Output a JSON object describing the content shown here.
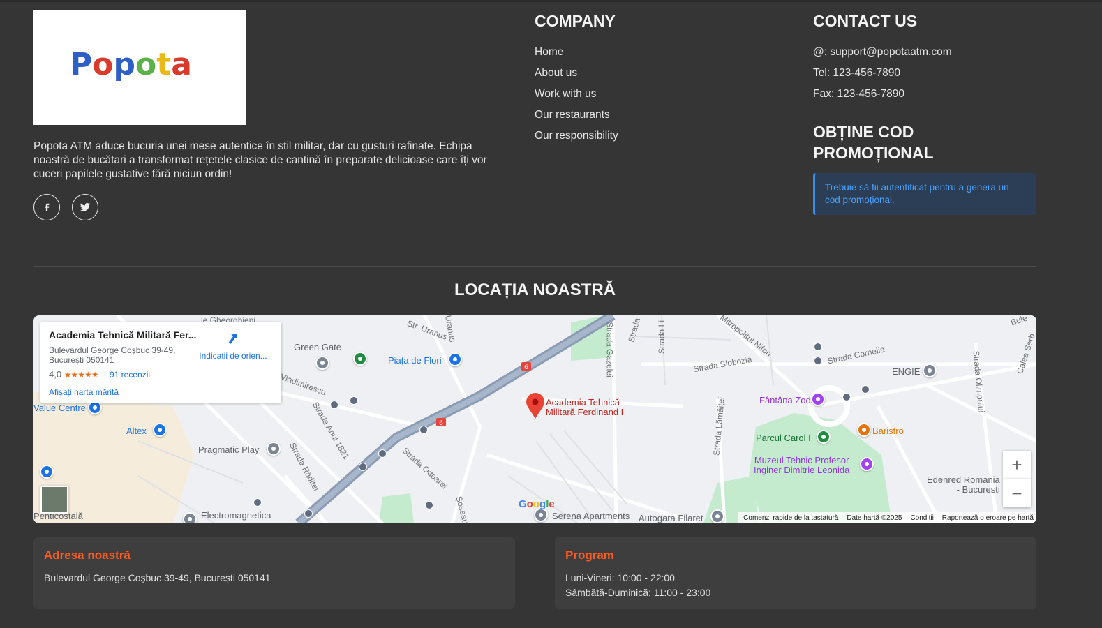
{
  "logo": {
    "text": "Popota"
  },
  "about": {
    "text": "Popota ATM aduce bucuria unei mese autentice în stil militar, dar cu gusturi rafinate. Echipa noastră de bucătari a transformat rețetele clasice de cantină în preparate delicioase care îți vor cuceri papilele gustative fără niciun ordin!"
  },
  "social": {
    "icons": [
      "facebook-icon",
      "twitter-icon"
    ]
  },
  "company": {
    "title": "COMPANY",
    "links": [
      "Home",
      "About us",
      "Work with us",
      "Our restaurants",
      "Our responsibility"
    ]
  },
  "contact": {
    "title": "CONTACT US",
    "email": "@: support@popotaatm.com",
    "tel": "Tel: 123-456-7890",
    "fax": "Fax: 123-456-7890"
  },
  "promo": {
    "title_line1": "OBȚINE COD",
    "title_line2": "PROMOȚIONAL",
    "alert": "Trebuie să fii autentificat pentru a genera un cod promoțional."
  },
  "location": {
    "title": "LOCAȚIA NOASTRĂ"
  },
  "map": {
    "place_name": "Academia Tehnică Militară Fer...",
    "address_line1": "Bulevardul George Coșbuc 39-49,",
    "address_line2": "București 050141",
    "rating": "4,0",
    "stars": "★★★★★",
    "reviews": "91 recenzii",
    "directions": "Indicații de orien...",
    "view_larger": "Afișați harta mărită",
    "marker_line1": "Academia Tehnică",
    "marker_line2": "Militară Ferdinand I",
    "labels": {
      "green_gate": "Green Gate",
      "piata": "Piața de Flori",
      "value_centre": "Value Centre",
      "altex": "Altex",
      "pragmatic": "Pragmatic Play",
      "electromagnetica": "Electromagnetica",
      "penticostala": "Penticostală",
      "serena": "Serena Apartments",
      "autogara": "Autogara Filaret",
      "fantana": "Fântâna Zodiac",
      "parcul": "Parcul Carol I",
      "baristro": "Baristro",
      "muzeul1": "Muzeul Tehnic Profesor",
      "muzeul2": "Inginer Dimitrie Leonida",
      "engie": "ENGIE",
      "edenred1": "Edenred Romania",
      "edenred2": "- Bucuresti",
      "s_gazelei": "Strada Gazelei",
      "s_slobozia": "Strada Slobozia",
      "s_cornelia": "Strada Cornelia",
      "s_nifon": "Mitropolitul Nifon",
      "s_vladimirescu": "Vladimirescu",
      "s_anul": "Strada Anul 1821",
      "s_raditei": "Strada Răditei",
      "s_odoarei": "Strada Odoarei",
      "s_uranus1": "Str. Uranus",
      "s_uranus2": "Uranus",
      "s_lamaitei": "Strada Lămâiței",
      "s_olimpului": "Strada Olimpului",
      "s_gheorghieni": "le Gheorghieni",
      "s_soseaua": "Șoseau",
      "s_calea": "Calea Serb",
      "s_strada": "Strada",
      "s_strada_li": "Strada Li",
      "s_bule": "Bule",
      "s_cu": "cu",
      "road6": "6"
    },
    "google": "Google",
    "footer": [
      "Comenzi rapide de la tastatură",
      "Date hartă ©2025",
      "Condiții",
      "Raportează o eroare pe hartă"
    ],
    "zoom_in": "+",
    "zoom_out": "−"
  },
  "address_card": {
    "title": "Adresa noastră",
    "text": "Bulevardul George Coșbuc 39-49, București 050141"
  },
  "program_card": {
    "title": "Program",
    "weekdays": "Luni-Vineri: 10:00 - 22:00",
    "weekend": "Sâmbătă-Duminică: 11:00 - 23:00"
  },
  "colors": {
    "background": "#353535",
    "accent": "#ff5a1f",
    "alert_text": "#4aa3ff",
    "map_pin": "#ea4335"
  }
}
